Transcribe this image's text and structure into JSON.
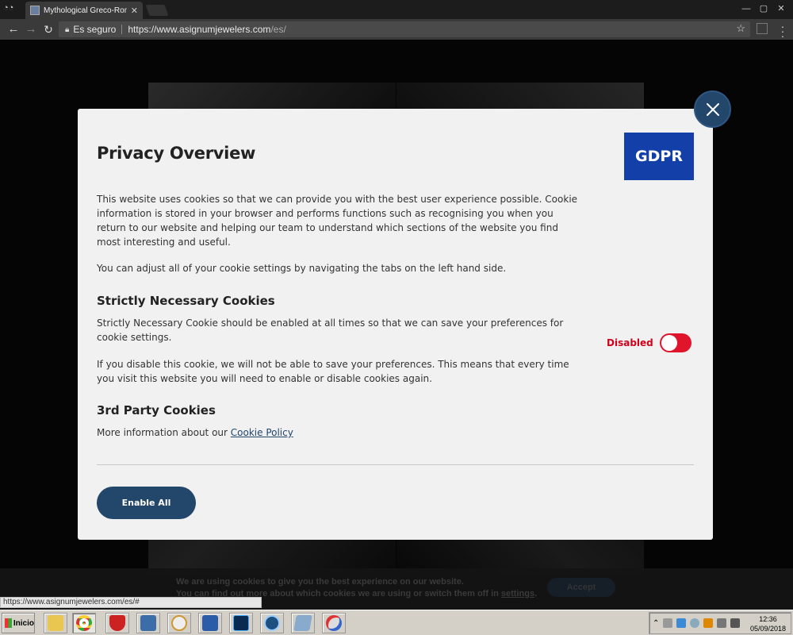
{
  "browser": {
    "tab_title": "Mythological Greco-Roman",
    "tab_close": "✕",
    "security_label": "Es seguro",
    "url_base": "https://www.asignumjewelers.com",
    "url_path": "/es/",
    "status_url": "https://www.asignumjewelers.com/es/#",
    "window_controls": [
      "—",
      "▢",
      "✕"
    ]
  },
  "modal": {
    "title": "Privacy Overview",
    "badge": "GDPR",
    "intro": "This website uses cookies so that we can provide you with the best user experience possible. Cookie information is stored in your browser and performs functions such as recognising you when you return to our website and helping our team to understand which sections of the website you find most interesting and useful.",
    "adjust": "You can adjust all of your cookie settings by navigating the tabs on the left hand side.",
    "necessary_heading": "Strictly Necessary Cookies",
    "necessary_text": "Strictly Necessary Cookie should be enabled at all times so that we can save your preferences for cookie settings.",
    "disable_warning": "If you disable this cookie, we will not be able to save your preferences. This means that every time you visit this website you will need to enable or disable cookies again.",
    "toggle_label": "Disabled",
    "toggle_state": false,
    "third_party_heading": "3rd Party Cookies",
    "third_party_text": "More information about our ",
    "cookie_policy_link": "Cookie Policy",
    "enable_all": "Enable All"
  },
  "cookie_bar": {
    "line1": "We are using cookies to give you the best experience on our website.",
    "line2": "You can find out more about which cookies we are using or switch them off in ",
    "settings_link": "settings",
    "accept": "Accept"
  },
  "taskbar": {
    "start_label": "Inicio",
    "time": "12:36",
    "date": "05/09/2018",
    "icons": [
      "folder-icon",
      "chrome-icon",
      "shield-app-icon",
      "monitor-app-icon",
      "globe-app-icon",
      "word-icon",
      "photoshop-icon",
      "speedometer-app-icon",
      "notepad-icon",
      "paint-icon"
    ]
  },
  "colors": {
    "accent": "#23466b",
    "gdpr_badge": "#1340a8",
    "toggle_off": "#e0142a",
    "disabled_text": "#d0021b"
  }
}
